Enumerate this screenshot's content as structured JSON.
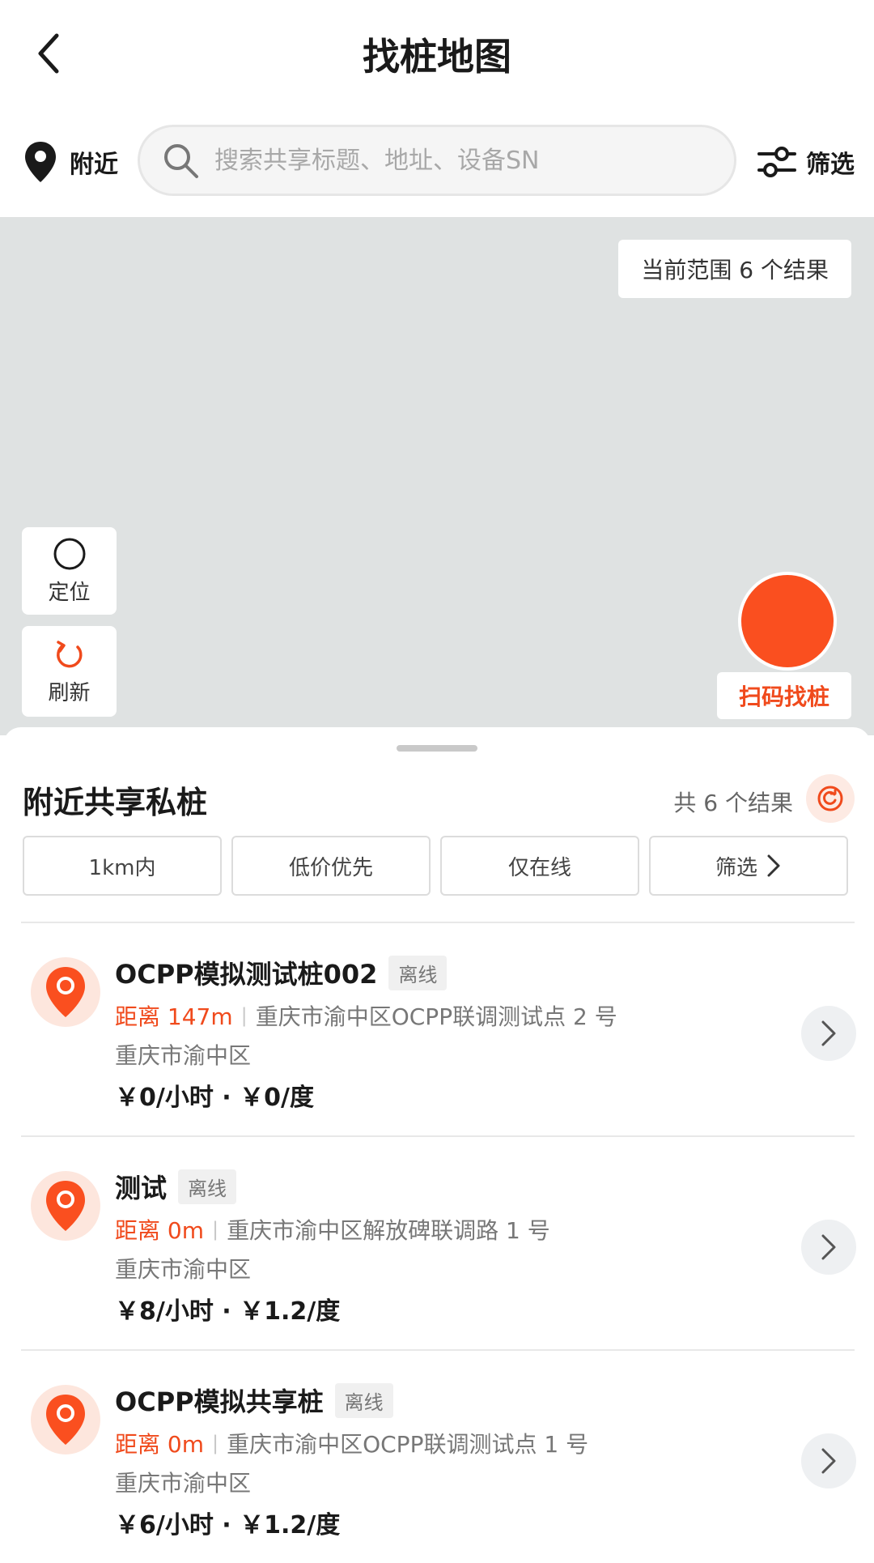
{
  "header": {
    "title": "找桩地图"
  },
  "search": {
    "nearby_label": "附近",
    "placeholder": "搜索共享标题、地址、设备SN",
    "filter_label": "筛选"
  },
  "map": {
    "result_badge": "当前范围 6 个结果",
    "locate_label": "定位",
    "refresh_label": "刷新",
    "scan_label": "扫码找桩"
  },
  "sheet": {
    "title": "附近共享私桩",
    "total": "共 6 个结果",
    "chips": [
      "1km内",
      "低价优先",
      "仅在线",
      "筛选"
    ],
    "items": [
      {
        "name": "OCPP模拟测试桩002",
        "status": "离线",
        "distance": "距离 147m",
        "address": "重庆市渝中区OCPP联调测试点 2 号",
        "district": "重庆市渝中区",
        "price": "￥0/小时 · ￥0/度"
      },
      {
        "name": "测试",
        "status": "离线",
        "distance": "距离 0m",
        "address": "重庆市渝中区解放碑联调路 1 号",
        "district": "重庆市渝中区",
        "price": "￥8/小时 · ￥1.2/度"
      },
      {
        "name": "OCPP模拟共享桩",
        "status": "离线",
        "distance": "距离 0m",
        "address": "重庆市渝中区OCPP联调测试点 1 号",
        "district": "重庆市渝中区",
        "price": "￥6/小时 · ￥1.2/度"
      }
    ]
  },
  "colors": {
    "accent": "#f04a1c",
    "map_bg": "#dfe2e2"
  }
}
